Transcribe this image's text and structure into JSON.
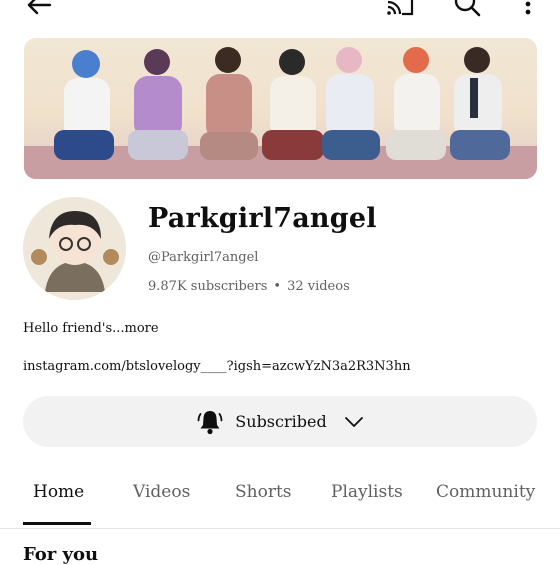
{
  "topbar": {
    "back_icon": "arrow-left-icon",
    "cast_icon": "cast-icon",
    "search_icon": "search-icon",
    "more_icon": "more-vertical-icon"
  },
  "channel": {
    "name": "Parkgirl7angel",
    "handle": "@Parkgirl7angel",
    "subscribers": "9.87K subscribers",
    "separator": "•",
    "videos": "32 videos",
    "description": "Hello friend's",
    "more_label": "...more",
    "link": "instagram.com/btslovelogy____?igsh=azcwYzN3a2R3N3hn"
  },
  "subscribe": {
    "label": "Subscribed",
    "bell_icon": "bell-icon",
    "chevron_icon": "chevron-down-icon"
  },
  "tabs": [
    {
      "label": "Home",
      "active": true
    },
    {
      "label": "Videos",
      "active": false
    },
    {
      "label": "Shorts",
      "active": false
    },
    {
      "label": "Playlists",
      "active": false
    },
    {
      "label": "Community",
      "active": false
    }
  ],
  "section": {
    "title": "For you"
  },
  "colors": {
    "text": "#0f0f0f",
    "secondary_text": "#606060",
    "button_bg": "#f2f2f2",
    "divider": "#e5e5e5"
  }
}
